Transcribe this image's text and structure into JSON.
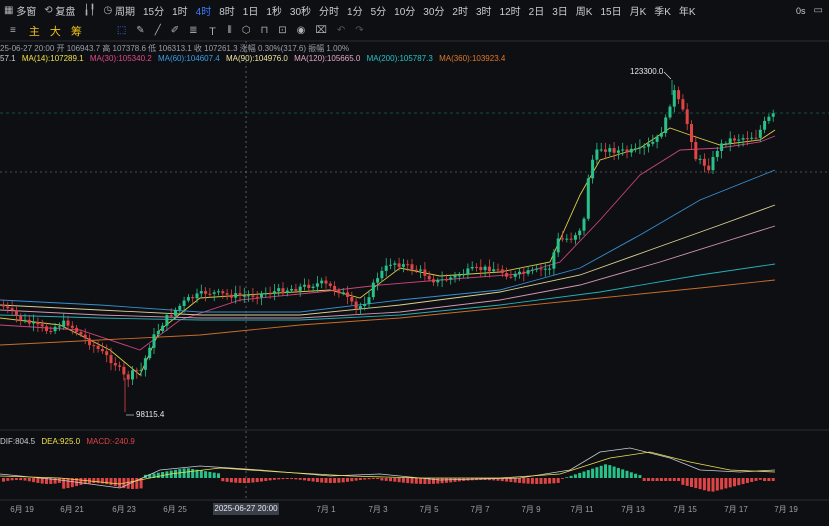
{
  "toolbar": {
    "items": [
      {
        "label": "多窗",
        "icon": "grid-icon"
      },
      {
        "label": "复盘",
        "icon": "replay-icon"
      },
      {
        "label": "",
        "icon": "candle-type-icon"
      },
      {
        "label": "周期",
        "icon": "clock-icon"
      },
      {
        "label": "15分"
      },
      {
        "label": "1时"
      },
      {
        "label": "4时",
        "active": true
      },
      {
        "label": "8时"
      },
      {
        "label": "1日"
      },
      {
        "label": "1秒"
      },
      {
        "label": "30秒"
      },
      {
        "label": "分时"
      },
      {
        "label": "1分"
      },
      {
        "label": "5分"
      },
      {
        "label": "10分"
      },
      {
        "label": "30分"
      },
      {
        "label": "2时"
      },
      {
        "label": "3时"
      },
      {
        "label": "12时"
      },
      {
        "label": "2日"
      },
      {
        "label": "3日"
      },
      {
        "label": "周K"
      },
      {
        "label": "15日"
      },
      {
        "label": "月K"
      },
      {
        "label": "季K"
      },
      {
        "label": "年K"
      }
    ],
    "right_label": "0s",
    "accent": "#3d7bff"
  },
  "toolbar2": {
    "items": [
      {
        "label": "主",
        "color": "#f0c419"
      },
      {
        "label": "大",
        "color": "#f0c419"
      },
      {
        "label": "筹",
        "color": "#f0c419"
      }
    ],
    "tool_icons": [
      "select-icon",
      "pen-icon",
      "line-icon",
      "brush-icon",
      "fib-icon",
      "text-icon",
      "bars-icon",
      "shape-icon",
      "magnet-icon",
      "lock-icon",
      "eye-icon",
      "trash-icon",
      "undo-icon",
      "redo-icon"
    ]
  },
  "info_line": "25-06-27 20:00  开 106943.7 高 107378.6 低 106313.1 收 107261.3 涨幅 0.30%(317.6) 振幅 1.00%",
  "ma_line": [
    {
      "label": "57.1",
      "color": "#c9cdd4"
    },
    {
      "label": "MA(14):107289.1",
      "color": "#f0e14a"
    },
    {
      "label": "MA(30):105340.2",
      "color": "#e04a8a"
    },
    {
      "label": "MA(60):104607.4",
      "color": "#3a9ee8"
    },
    {
      "label": "MA(90):104976.0",
      "color": "#f2e6a0"
    },
    {
      "label": "MA(120):105665.0",
      "color": "#e7a6c9"
    },
    {
      "label": "MA(200):105787.3",
      "color": "#27c3c9"
    },
    {
      "label": "MA(360):103923.4",
      "color": "#e0782a"
    }
  ],
  "macd_line": [
    {
      "label": "DIF:804.5",
      "color": "#c9cdd4"
    },
    {
      "label": "DEA:925.0",
      "color": "#f0e14a"
    },
    {
      "label": "MACD:-240.9",
      "color": "#e04545"
    }
  ],
  "annotations": {
    "high": "123300.0",
    "low": "98115.4"
  },
  "crosshair_label": "2025-06-27 20:00",
  "x_labels": [
    "6月 19",
    "6月 21",
    "6月 23",
    "6月 25",
    "6月 27",
    "7月 1",
    "7月 3",
    "7月 5",
    "7月 7",
    "7月 9",
    "7月 11",
    "7月 13",
    "7月 15",
    "7月 17",
    "7月 19"
  ],
  "colors": {
    "up": "#26c28a",
    "down": "#e04545",
    "bg": "#0e0f13"
  }
}
